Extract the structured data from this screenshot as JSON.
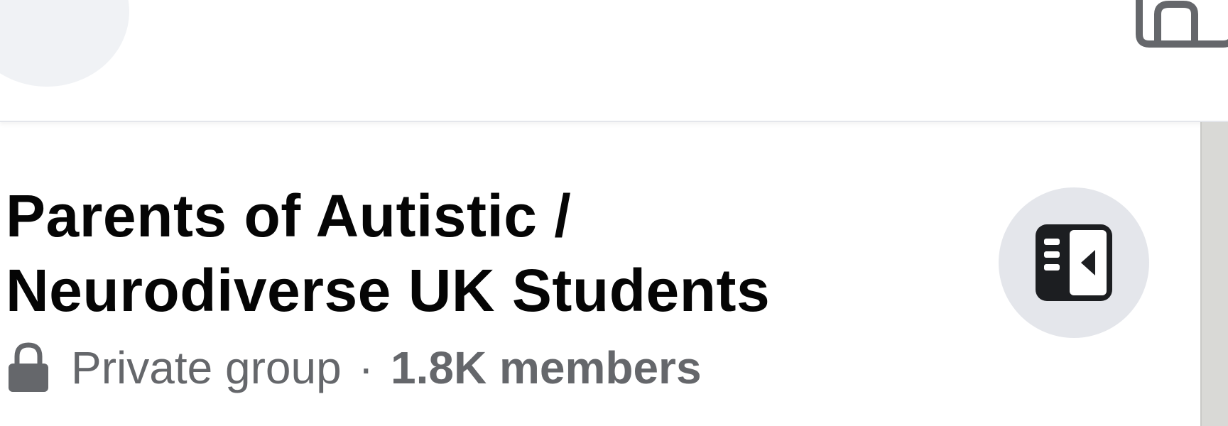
{
  "header": {
    "search_icon": "search-icon",
    "home_icon": "home-icon"
  },
  "group": {
    "title": "Parents of Autistic / Neurodiverse UK Students",
    "privacy_icon": "lock-icon",
    "privacy": "Private group",
    "separator": "·",
    "members": "1.8K members",
    "info_icon": "side-panel-icon"
  },
  "colors": {
    "title_text": "#050505",
    "secondary_text": "#65676b",
    "button_bg": "#e4e6eb",
    "search_bg": "#f0f2f5",
    "icon_dark": "#1c1e21"
  }
}
